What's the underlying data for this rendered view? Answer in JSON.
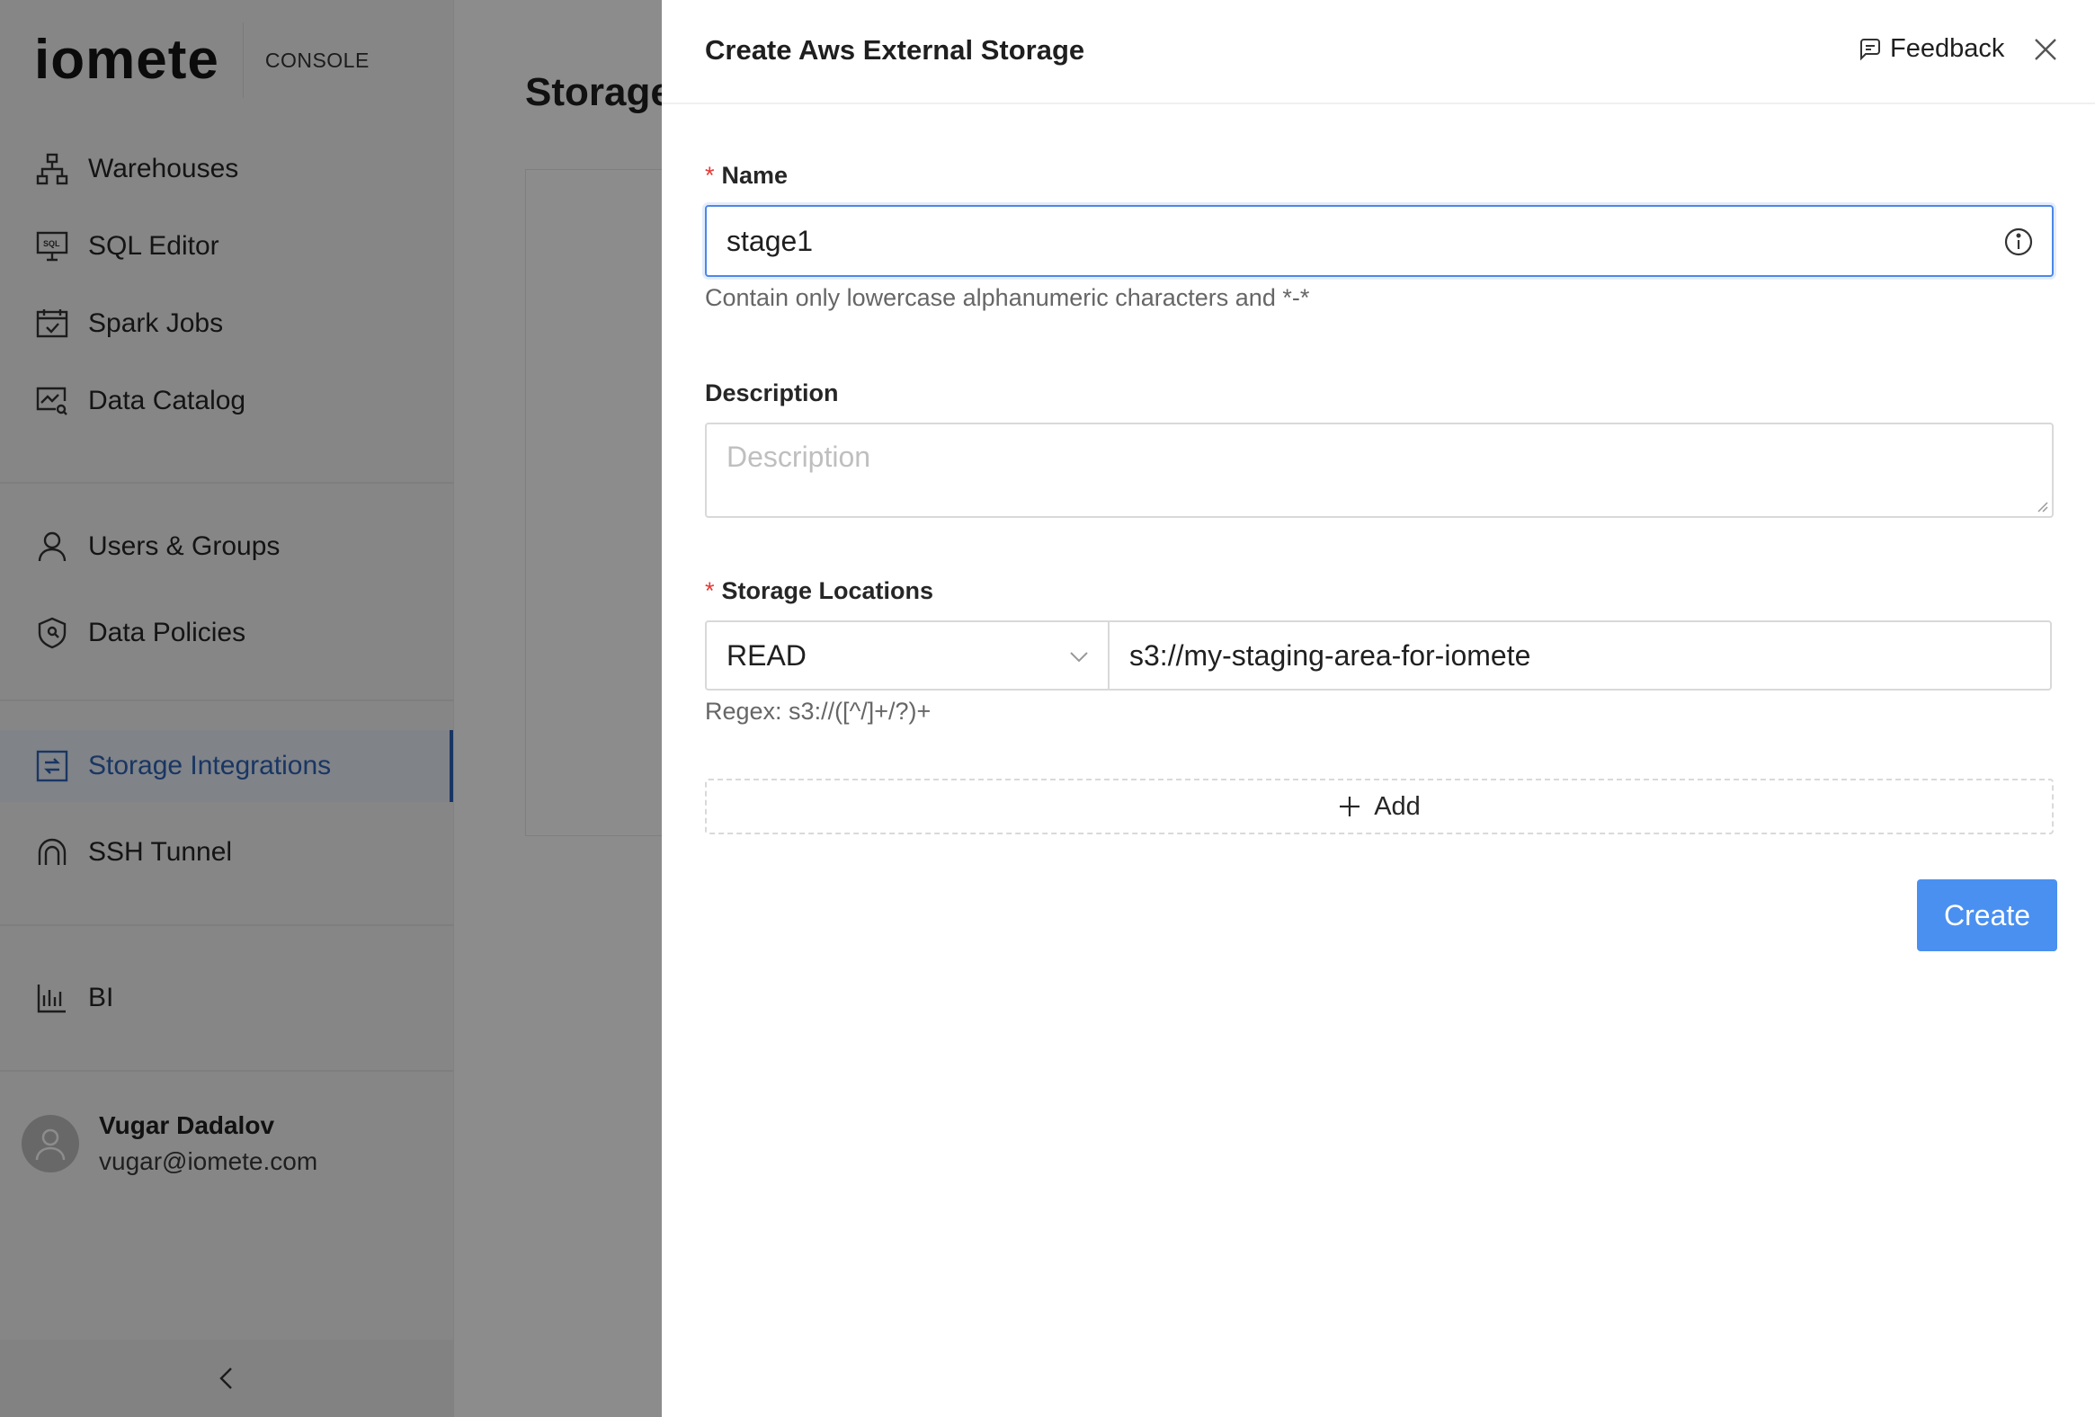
{
  "brand": {
    "logo": "iomete",
    "console": "CONSOLE"
  },
  "sidebar": {
    "items": [
      {
        "label": "Warehouses",
        "icon": "sitemap-icon",
        "active": false
      },
      {
        "label": "SQL Editor",
        "icon": "sql-monitor-icon",
        "active": false
      },
      {
        "label": "Spark Jobs",
        "icon": "calendar-check-icon",
        "active": false
      },
      {
        "label": "Data Catalog",
        "icon": "catalog-search-icon",
        "active": false
      },
      {
        "label": "Users & Groups",
        "icon": "user-icon",
        "active": false
      },
      {
        "label": "Data Policies",
        "icon": "shield-icon",
        "active": false
      },
      {
        "label": "Storage Integrations",
        "icon": "storage-icon",
        "active": true
      },
      {
        "label": "SSH Tunnel",
        "icon": "tunnel-icon",
        "active": false
      },
      {
        "label": "BI",
        "icon": "bar-chart-icon",
        "active": false
      }
    ],
    "user": {
      "name": "Vugar Dadalov",
      "email": "vugar@iomete.com"
    }
  },
  "main": {
    "title": "Storage"
  },
  "drawer": {
    "title": "Create Aws External Storage",
    "feedback_label": "Feedback",
    "name": {
      "label": "Name",
      "required_mark": "*",
      "value": "stage1",
      "help": "Contain only lowercase alphanumeric characters and *-*"
    },
    "description": {
      "label": "Description",
      "placeholder": "Description",
      "value": ""
    },
    "storage_locations": {
      "label": "Storage Locations",
      "required_mark": "*",
      "permission": "READ",
      "location": "s3://my-staging-area-for-iomete",
      "help": "Regex: s3://([^/]+/?)+"
    },
    "add_label": "Add",
    "create_label": "Create"
  },
  "colors": {
    "accent": "#4a90f0",
    "active_nav": "#2f63b5",
    "required": "#e53935"
  }
}
